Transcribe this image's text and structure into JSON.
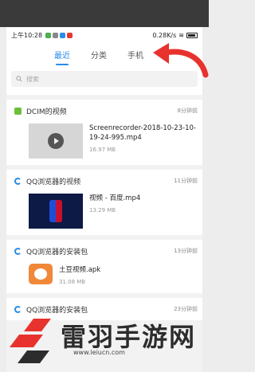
{
  "status_bar": {
    "time": "上午10:28",
    "net_speed": "0.28K/s"
  },
  "tabs": [
    {
      "label": "最近",
      "active": true
    },
    {
      "label": "分类",
      "active": false
    },
    {
      "label": "手机",
      "active": false
    }
  ],
  "search": {
    "placeholder": "搜索"
  },
  "sections": [
    {
      "title": "DCIM的视频",
      "time": "8分钟前",
      "item": {
        "name": "Screenrecorder-2018-10-23-10-19-24-995.mp4",
        "size": "16.97 MB"
      }
    },
    {
      "title": "QQ浏览器的视频",
      "time": "11分钟前",
      "item": {
        "name": "视频 - 百度.mp4",
        "size": "13.29 MB"
      }
    },
    {
      "title": "QQ浏览器的安装包",
      "time": "13分钟前",
      "item": {
        "name": "土豆视频.apk",
        "size": "31.08 MB"
      }
    },
    {
      "title": "QQ浏览器的安装包",
      "time": "23分钟前"
    }
  ],
  "watermark": {
    "title": "雷羽手游网",
    "url": "www.leiucn.com"
  },
  "colors": {
    "accent": "#2a8be8",
    "arrow": "#e8322d",
    "dcim": "#6cbf3a"
  }
}
